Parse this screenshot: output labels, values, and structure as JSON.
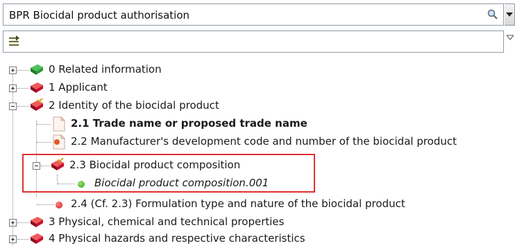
{
  "search": {
    "value": "BPR Biocidal product authorisation",
    "search_icon": "magnifier-icon",
    "dropdown_icon": "chevron-down-icon"
  },
  "filter": {
    "icon": "filter-arrows-icon"
  },
  "tree": {
    "items": [
      {
        "label": "0 Related information",
        "icon": "book-green-icon",
        "state": "collapsed"
      },
      {
        "label": "1 Applicant",
        "icon": "book-red-icon",
        "state": "collapsed"
      },
      {
        "label": "2 Identity of the biocidal product",
        "icon": "book-red-check-icon",
        "state": "expanded"
      },
      {
        "label": "2.1 Trade name or proposed trade name",
        "icon": "document-icon",
        "bold": true
      },
      {
        "label": "2.2 Manufacturer's development code and number of the biocidal product",
        "icon": "document-warning-icon"
      },
      {
        "label": "2.3 Biocidal product composition",
        "icon": "book-red-check-icon",
        "state": "expanded"
      },
      {
        "label": "Biocidal product composition.001",
        "icon": "green-dot-icon",
        "italic": true
      },
      {
        "label": "2.4 (Cf. 2.3) Formulation type and nature of the biocidal product",
        "icon": "red-dot-icon"
      },
      {
        "label": "3 Physical, chemical and technical properties",
        "icon": "book-red-icon",
        "state": "collapsed"
      },
      {
        "label": "4 Physical hazards and respective characteristics",
        "icon": "book-red-icon",
        "state": "collapsed"
      }
    ]
  },
  "colors": {
    "highlight_border": "#e03030",
    "book_red": "#c8102e",
    "book_green": "#2e9a3a"
  }
}
